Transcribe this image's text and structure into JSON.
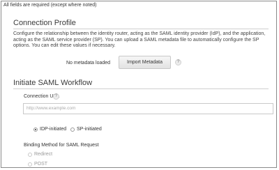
{
  "top_note": "All fields are required (except where noted)",
  "connection_profile": {
    "title": "Connection Profile",
    "description": "Configure the relationship between the identity router, acting as the SAML identity provider (IdP), and the application, acting as the SAML service provider (SP). You can upload a SAML metadata file to automatically configure the SP options. You can edit these values if necessary.",
    "metadata_status": "No metadata loaded",
    "import_button": "Import Metadata",
    "help_glyph": "?"
  },
  "saml_workflow": {
    "title": "Initiate SAML Workflow",
    "connection_url_label": "Connection URL",
    "help_glyph": "?",
    "connection_url_placeholder": "http://www.example.com",
    "connection_url_value": "",
    "initiation_options": [
      {
        "label": "IDP-initiated",
        "selected": true
      },
      {
        "label": "SP-initiated",
        "selected": false
      }
    ],
    "binding_label": "Binding Method for SAML Request",
    "binding_options": [
      {
        "label": "Redirect",
        "selected": false,
        "disabled": true
      },
      {
        "label": "POST",
        "selected": false,
        "disabled": true
      }
    ]
  },
  "colors": {
    "border": "#8a8a8a",
    "divider": "#cfcfcf",
    "text": "#333333",
    "disabled_text": "#9a9a9a"
  }
}
